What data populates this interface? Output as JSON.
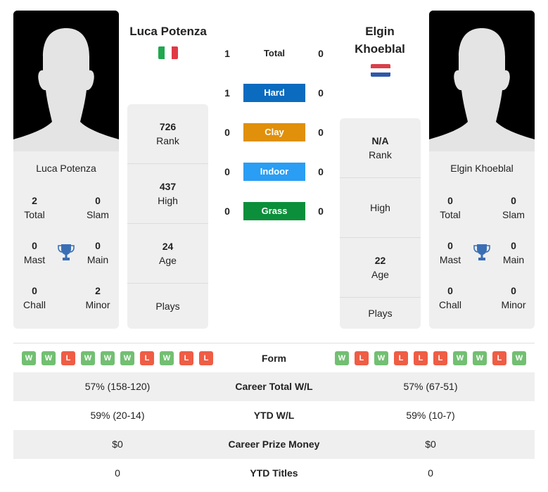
{
  "left_player": {
    "name": "Luca Potenza",
    "country": "Italy",
    "flag_colors": [
      "#1fa84f",
      "#ffffff",
      "#e03a45"
    ],
    "titles": {
      "total": {
        "value": "2",
        "label": "Total"
      },
      "slam": {
        "value": "0",
        "label": "Slam"
      },
      "mast": {
        "value": "0",
        "label": "Mast"
      },
      "main": {
        "value": "0",
        "label": "Main"
      },
      "chall": {
        "value": "0",
        "label": "Chall"
      },
      "minor": {
        "value": "2",
        "label": "Minor"
      }
    },
    "stats": {
      "rank": {
        "value": "726",
        "label": "Rank"
      },
      "high": {
        "value": "437",
        "label": "High"
      },
      "age": {
        "value": "24",
        "label": "Age"
      },
      "plays": {
        "value": "",
        "label": "Plays"
      }
    },
    "form": [
      "W",
      "W",
      "L",
      "W",
      "W",
      "W",
      "L",
      "W",
      "L",
      "L"
    ]
  },
  "right_player": {
    "name_line1": "Elgin",
    "name_line2": "Khoeblal",
    "name": "Elgin Khoeblal",
    "country": "Netherlands",
    "flag_colors": [
      "#d8404a",
      "#ffffff",
      "#2f58a8"
    ],
    "titles": {
      "total": {
        "value": "0",
        "label": "Total"
      },
      "slam": {
        "value": "0",
        "label": "Slam"
      },
      "mast": {
        "value": "0",
        "label": "Mast"
      },
      "main": {
        "value": "0",
        "label": "Main"
      },
      "chall": {
        "value": "0",
        "label": "Chall"
      },
      "minor": {
        "value": "0",
        "label": "Minor"
      }
    },
    "stats": {
      "rank": {
        "value": "N/A",
        "label": "Rank"
      },
      "high": {
        "value": "",
        "label": "High"
      },
      "age": {
        "value": "22",
        "label": "Age"
      },
      "plays": {
        "value": "",
        "label": "Plays"
      }
    },
    "form": [
      "W",
      "L",
      "W",
      "L",
      "L",
      "L",
      "W",
      "W",
      "L",
      "W"
    ]
  },
  "head_to_head": [
    {
      "surface": "Total",
      "left": "1",
      "right": "0",
      "color": ""
    },
    {
      "surface": "Hard",
      "left": "1",
      "right": "0",
      "color": "#0b6bbf"
    },
    {
      "surface": "Clay",
      "left": "0",
      "right": "0",
      "color": "#e0900a"
    },
    {
      "surface": "Indoor",
      "left": "0",
      "right": "0",
      "color": "#2a9df4"
    },
    {
      "surface": "Grass",
      "left": "0",
      "right": "0",
      "color": "#0c8f3a"
    }
  ],
  "form_label": "Form",
  "comparison": [
    {
      "label": "Career Total W/L",
      "left": "57% (158-120)",
      "right": "57% (67-51)"
    },
    {
      "label": "YTD W/L",
      "left": "59% (20-14)",
      "right": "59% (10-7)"
    },
    {
      "label": "Career Prize Money",
      "left": "$0",
      "right": "$0"
    },
    {
      "label": "YTD Titles",
      "left": "0",
      "right": "0"
    }
  ],
  "icons": {
    "photo": "person-silhouette-icon",
    "trophy": "trophy-icon",
    "trophy_color": "#3a6fb5"
  }
}
